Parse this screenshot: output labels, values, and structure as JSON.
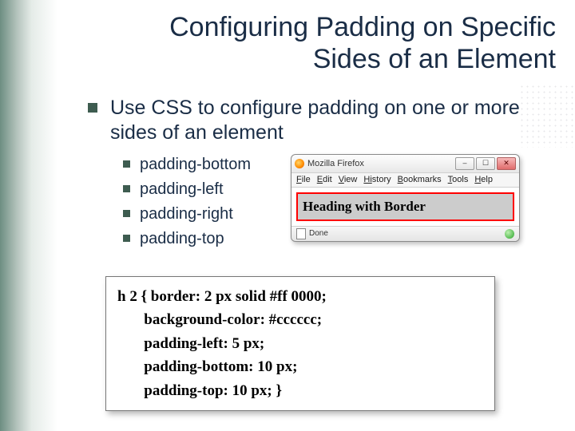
{
  "title": "Configuring Padding on Specific Sides of an Element",
  "bullet1": "Use CSS to configure padding on one or more sides of an element",
  "sub": {
    "a": "padding-bottom",
    "b": "padding-left",
    "c": "padding-right",
    "d": "padding-top"
  },
  "browser": {
    "app": "Mozilla Firefox",
    "min_glyph": "–",
    "max_glyph": "☐",
    "close_glyph": "✕",
    "menu": {
      "file": "File",
      "edit": "Edit",
      "view": "View",
      "history": "History",
      "bookmarks": "Bookmarks",
      "tools": "Tools",
      "help": "Help",
      "file_u": "F",
      "edit_u": "E",
      "view_u": "V",
      "history_u": "Hi",
      "history_rest": "story",
      "bookmarks_u": "B",
      "tools_u": "T",
      "help_u": "H"
    },
    "heading": "Heading with Border",
    "status": "Done"
  },
  "code": "h 2 { border: 2 px solid #ff 0000;\n       background-color: #cccccc;\n       padding-left: 5 px;\n       padding-bottom: 10 px;\n       padding-top: 10 px; }"
}
